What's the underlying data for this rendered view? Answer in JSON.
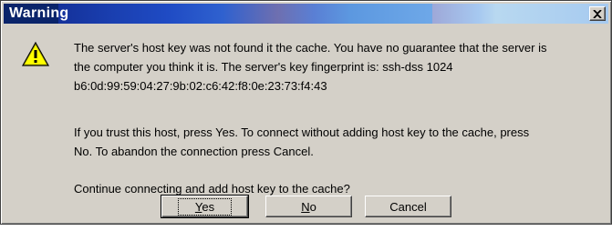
{
  "dialog": {
    "title": "Warning",
    "close_label": "×",
    "message_lines": [
      "The server's host key was not found it the cache. You have no guarantee that the server is",
      "the computer you think it is. The server's key fingerprint is: ssh-dss 1024",
      "b6:0d:99:59:04:27:9b:02:c6:42:f8:0e:23:73:f4:43",
      "If you trust this host, press Yes. To connect without adding host key to the cache, press",
      "No. To abandon the connection press Cancel.",
      "Continue connecting and add host key to the cache?"
    ],
    "icon": "warning-triangle-icon",
    "buttons": {
      "yes": {
        "mnemonic": "Y",
        "rest": "es"
      },
      "no": {
        "mnemonic": "N",
        "rest": "o"
      },
      "cancel": {
        "label": "Cancel"
      }
    }
  },
  "colors": {
    "dialog_bg": "#d4d0c8",
    "title_text": "#ffffff",
    "title_dark": "#0a246a",
    "title_light": "#a6caf0",
    "warning_yellow": "#ffff00"
  }
}
